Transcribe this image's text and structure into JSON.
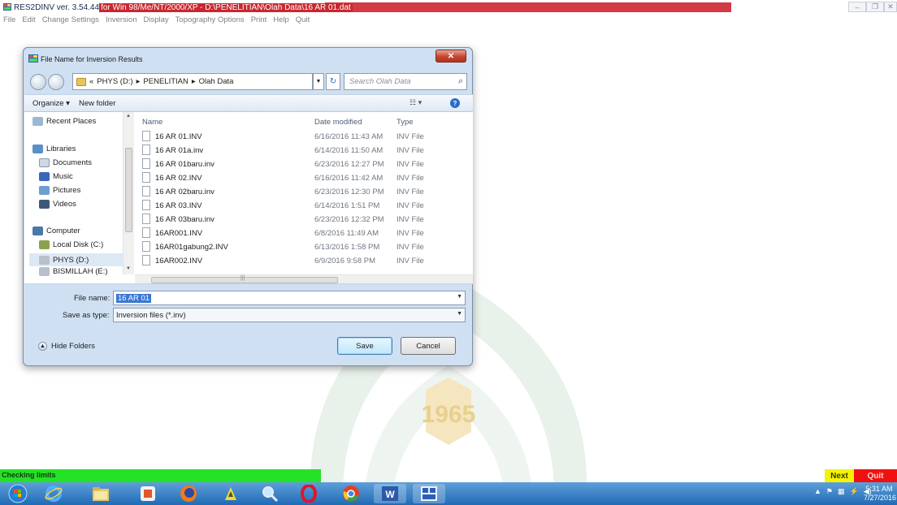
{
  "app": {
    "title_main": "RES2DINV ver. 3.54.44 ",
    "title_highlight": "for Win 98/Me/NT/2000/XP - D:\\PENELITIAN\\Olah Data\\16 AR 01.dat",
    "menu": [
      "File",
      "Edit",
      "Change Settings",
      "Inversion",
      "Display",
      "Topography Options",
      "Print",
      "Help",
      "Quit"
    ]
  },
  "dialog": {
    "title": "File Name for Inversion Results",
    "close_label": "✕",
    "breadcrumb": [
      "«",
      "PHYS (D:)",
      "▸",
      "PENELITIAN",
      "▸",
      "Olah Data"
    ],
    "search_placeholder": "Search Olah Data",
    "toolbar": {
      "organize": "Organize ▾",
      "new_folder": "New folder",
      "views": "☷ ▾",
      "help": "?"
    },
    "nav": [
      {
        "label": "Recent Places",
        "icon": "recent-places-icon",
        "color": "#9bb7d4"
      },
      {
        "label": "Libraries",
        "icon": "libraries-icon",
        "color": "#5b8fc9"
      },
      {
        "label": "Documents",
        "icon": "documents-icon",
        "color": "#cfd8e4"
      },
      {
        "label": "Music",
        "icon": "music-icon",
        "color": "#3a68b8"
      },
      {
        "label": "Pictures",
        "icon": "pictures-icon",
        "color": "#6e9ed0"
      },
      {
        "label": "Videos",
        "icon": "videos-icon",
        "color": "#3f5878"
      },
      {
        "label": "Computer",
        "icon": "computer-icon",
        "color": "#4a78a8"
      },
      {
        "label": "Local Disk (C:)",
        "icon": "local-disk-icon",
        "color": "#8aa04a"
      },
      {
        "label": "PHYS (D:)",
        "icon": "drive-icon",
        "color": "#b7c0cb"
      },
      {
        "label": "BISMILLAH (E:)",
        "icon": "drive-icon",
        "color": "#b7c0cb"
      }
    ],
    "columns": {
      "name": "Name",
      "date": "Date modified",
      "type": "Type"
    },
    "files": [
      {
        "name": "16 AR 01.INV",
        "date": "6/16/2016 11:43 AM",
        "type": "INV File"
      },
      {
        "name": "16 AR 01a.inv",
        "date": "6/14/2016 11:50 AM",
        "type": "INV File"
      },
      {
        "name": "16 AR 01baru.inv",
        "date": "6/23/2016 12:27 PM",
        "type": "INV File"
      },
      {
        "name": "16 AR 02.INV",
        "date": "6/16/2016 11:42 AM",
        "type": "INV File"
      },
      {
        "name": "16 AR 02baru.inv",
        "date": "6/23/2016 12:30 PM",
        "type": "INV File"
      },
      {
        "name": "16 AR 03.INV",
        "date": "6/14/2016 1:51 PM",
        "type": "INV File"
      },
      {
        "name": "16 AR 03baru.inv",
        "date": "6/23/2016 12:32 PM",
        "type": "INV File"
      },
      {
        "name": "16AR001.INV",
        "date": "6/8/2016 11:49 AM",
        "type": "INV File"
      },
      {
        "name": "16AR01gabung2.INV",
        "date": "6/13/2016 1:58 PM",
        "type": "INV File"
      },
      {
        "name": "16AR002.INV",
        "date": "6/9/2016 9:58 PM",
        "type": "INV File"
      }
    ],
    "file_name_label": "File name:",
    "file_name_value": "16 AR 01",
    "save_type_label": "Save as type:",
    "save_type_value": "Inversion files (*.inv)",
    "hide_folders": "Hide Folders",
    "save_label": "Save",
    "cancel_label": "Cancel"
  },
  "status": {
    "text": "Checking limits",
    "next_label": "Next",
    "quit_label": "Quit"
  },
  "watermark": {
    "text": "1965"
  },
  "taskbar": {
    "apps": [
      "start-orb-icon",
      "internet-explorer-icon",
      "file-explorer-icon",
      "media-player-icon",
      "firefox-icon",
      "winamp-icon",
      "search-tool-icon",
      "opera-icon",
      "chrome-icon",
      "word-icon",
      "res2dinv-icon"
    ],
    "tray_arrow": "▲",
    "time": "5:31 AM",
    "date": "7/27/2016"
  }
}
